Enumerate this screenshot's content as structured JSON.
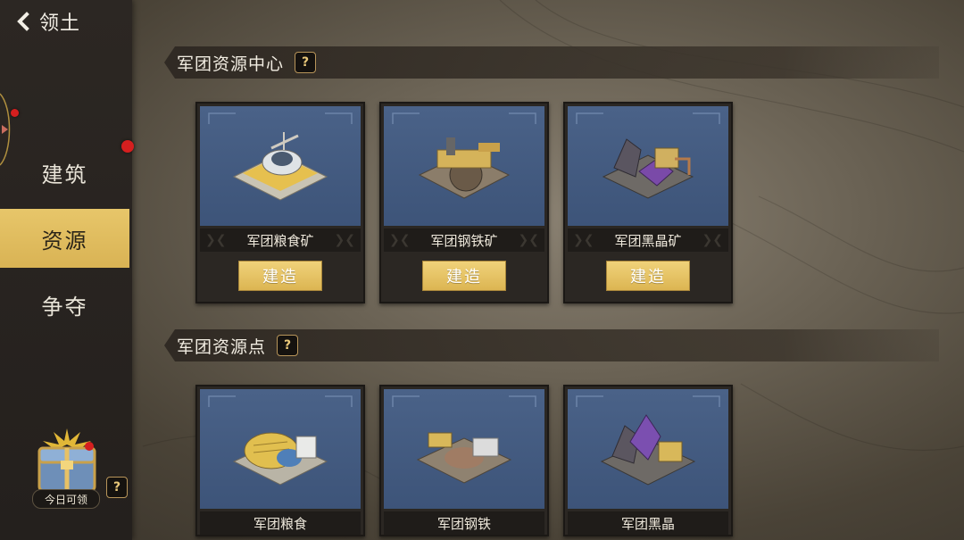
{
  "header": {
    "back_label": "领土"
  },
  "sidebar": {
    "items": [
      {
        "label": "建筑",
        "active": false
      },
      {
        "label": "资源",
        "active": true
      },
      {
        "label": "争夺",
        "active": false
      }
    ],
    "reward": {
      "label": "今日可领",
      "help": "?"
    }
  },
  "sections": [
    {
      "title": "军团资源中心",
      "help": "?",
      "cards": [
        {
          "name": "军团粮食矿",
          "button": "建造",
          "icon": "farm-building-icon"
        },
        {
          "name": "军团钢铁矿",
          "button": "建造",
          "icon": "steel-mine-building-icon"
        },
        {
          "name": "军团黑晶矿",
          "button": "建造",
          "icon": "crystal-mine-building-icon"
        }
      ]
    },
    {
      "title": "军团资源点",
      "help": "?",
      "cards": [
        {
          "name": "军团粮食",
          "icon": "food-point-icon"
        },
        {
          "name": "军团钢铁",
          "icon": "steel-point-icon"
        },
        {
          "name": "军团黑晶",
          "icon": "crystal-point-icon"
        }
      ]
    }
  ],
  "colors": {
    "accent": "#dcb552",
    "card_sky": "#4a6288",
    "sidebar": "#2c2723",
    "alert": "#d51f1f"
  }
}
